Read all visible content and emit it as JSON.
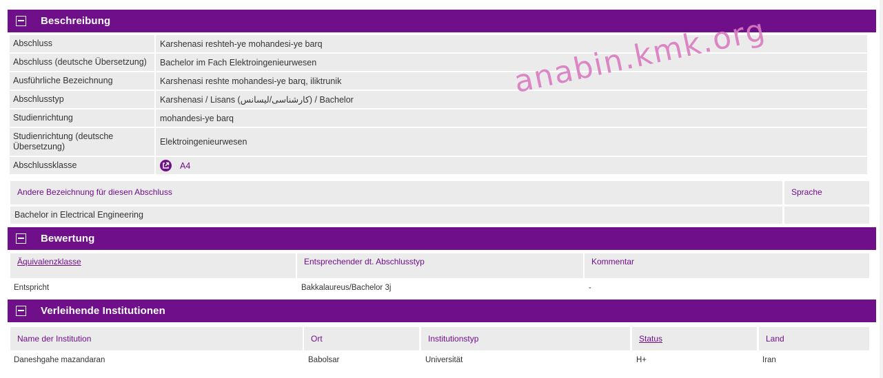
{
  "sections": {
    "beschreibung": "Beschreibung",
    "bewertung": "Bewertung",
    "institutionen": "Verleihende Institutionen"
  },
  "beschreibung_rows": [
    {
      "label": "Abschluss",
      "value": "Karshenasi reshteh-ye mohandesi-ye barq"
    },
    {
      "label": "Abschluss (deutsche Übersetzung)",
      "value": "Bachelor im Fach Elektroingenieurwesen"
    },
    {
      "label": "Ausführliche Bezeichnung",
      "value": "Karshenasi reshte mohandesi-ye barq, iliktrunik"
    },
    {
      "label": "Abschlusstyp",
      "value": "Karshenasi / Lisans (کارشناسی/لیسانس) / Bachelor"
    },
    {
      "label": "Studienrichtung",
      "value": "mohandesi-ye barq"
    },
    {
      "label": "Studienrichtung (deutsche Übersetzung)",
      "value": "Elektroingenieurwesen"
    },
    {
      "label": "Abschlussklasse",
      "value": "A4"
    }
  ],
  "andere": {
    "header_name": "Andere Bezeichnung für diesen Abschluss",
    "header_sprache": "Sprache",
    "row_name": "Bachelor in Electrical Engineering",
    "row_sprache": ""
  },
  "bewertung": {
    "headers": [
      "Äquivalenzklasse",
      "Entsprechender dt. Abschlusstyp",
      "Kommentar"
    ],
    "row": [
      "Entspricht",
      "Bakkalaureus/Bachelor 3j",
      "-"
    ]
  },
  "institutionen": {
    "headers": [
      "Name der Institution",
      "Ort",
      "Institutionstyp",
      "Status",
      "Land"
    ],
    "row": [
      "Daneshgahe mazandaran",
      "Babolsar",
      "Universität",
      "H+",
      "Iran"
    ]
  },
  "watermark": "anabin.kmk.org",
  "colors": {
    "accent": "#6f0f8a",
    "row_bg": "#ebebeb",
    "watermark": "#d97bc0"
  }
}
